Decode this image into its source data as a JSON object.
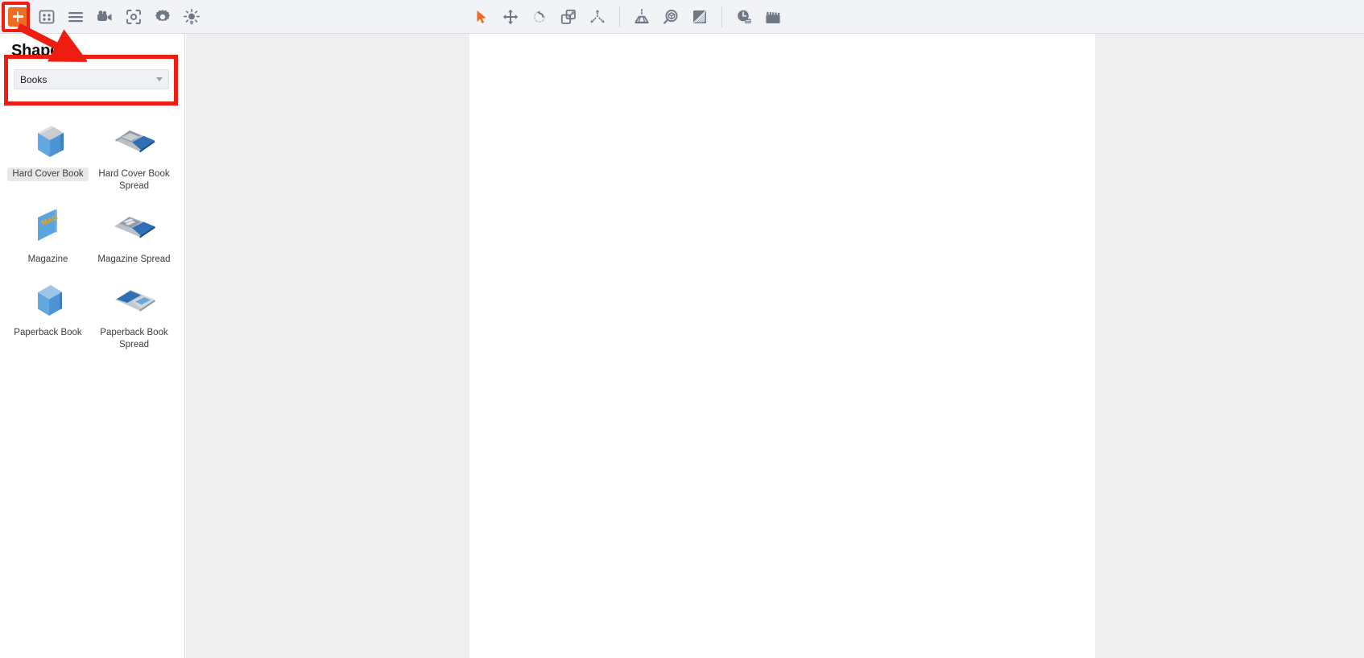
{
  "app": {
    "title": "Shapes panel — Books category"
  },
  "toolbar": {
    "left_buttons": [
      {
        "name": "add-shape-button",
        "icon": "plus-square-icon",
        "label": "Add",
        "active": true
      },
      {
        "name": "panels-button",
        "icon": "panels-grid-icon",
        "label": "Panels"
      },
      {
        "name": "menu-button",
        "icon": "hamburger-menu-icon",
        "label": "Menu"
      },
      {
        "name": "camera-button",
        "icon": "video-camera-icon",
        "label": "Camera"
      },
      {
        "name": "focus-button",
        "icon": "focus-brackets-icon",
        "label": "Focus"
      },
      {
        "name": "settings-button",
        "icon": "gear-icon",
        "label": "Settings"
      },
      {
        "name": "light-button",
        "icon": "sun-light-icon",
        "label": "Light"
      }
    ],
    "center_buttons": [
      {
        "name": "select-tool",
        "icon": "cursor-arrow-icon",
        "label": "Select",
        "active": true
      },
      {
        "name": "move-tool",
        "icon": "move-arrows-icon",
        "label": "Move"
      },
      {
        "name": "rotate-tool",
        "icon": "rotate-ccw-icon",
        "label": "Rotate"
      },
      {
        "name": "scale-tool",
        "icon": "scale-resize-icon",
        "label": "Scale"
      },
      {
        "name": "explode-tool",
        "icon": "explode-arrows-icon",
        "label": "Explode"
      },
      {
        "name": "perspective-tool",
        "icon": "perspective-grid-icon",
        "label": "Perspective"
      },
      {
        "name": "inspect-tool",
        "icon": "magnifier-box-icon",
        "label": "Inspect"
      },
      {
        "name": "render-tool",
        "icon": "render-square-icon",
        "label": "Render"
      },
      {
        "name": "timeline-tool",
        "icon": "clock-icon",
        "label": "Timeline"
      },
      {
        "name": "animation-tool",
        "icon": "clapperboard-icon",
        "label": "Animation"
      }
    ]
  },
  "sidebar": {
    "title": "Shapes",
    "category_picker": {
      "value": "Books",
      "placeholder": "Books",
      "caret_icon": "chevron-down-icon"
    },
    "shapes": [
      {
        "label": "Hard Cover Book",
        "thumb": "hard-cover-book",
        "highlighted": true
      },
      {
        "label": "Hard Cover Book Spread",
        "thumb": "hard-cover-book-spread",
        "highlighted": false
      },
      {
        "label": "Magazine",
        "thumb": "magazine",
        "highlighted": false
      },
      {
        "label": "Magazine Spread",
        "thumb": "magazine-spread",
        "highlighted": false
      },
      {
        "label": "Paperback Book",
        "thumb": "paperback-book",
        "highlighted": false
      },
      {
        "label": "Paperback Book Spread",
        "thumb": "paperback-book-spread",
        "highlighted": false
      }
    ]
  },
  "canvas": {
    "background_color": "#eeeeee",
    "page_color": "#ffffff"
  },
  "annotations": {
    "highlight_color": "#ee1c11",
    "accent_color": "#ef6c23",
    "boxes": [
      "add-shape-button",
      "category-picker"
    ],
    "arrow_from": "add-shape-button",
    "arrow_to": "category-picker"
  },
  "magazine_cover_text": "MAG"
}
